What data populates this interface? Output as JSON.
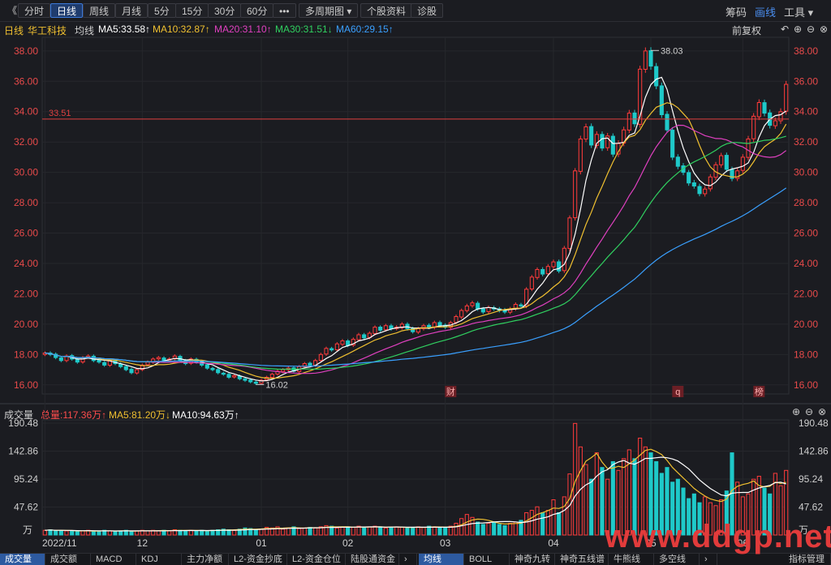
{
  "toolbar": {
    "back_glyph": "《",
    "periods": [
      "分时",
      "日线",
      "周线",
      "月线",
      "5分",
      "15分",
      "30分",
      "60分",
      "•••",
      "多周期图 ▾",
      "个股资料",
      "诊股"
    ],
    "active_period": "日线",
    "right_items": [
      "筹码",
      "画线",
      "工具 ▾"
    ],
    "right_active": "画线"
  },
  "indicator_row": {
    "period": "日线",
    "stock": "华工科技",
    "avg_label": "均线",
    "ma": [
      {
        "label": "MA5:33.58↑",
        "color": "#ffffff"
      },
      {
        "label": "MA10:32.87↑",
        "color": "#f0c030"
      },
      {
        "label": "MA20:31.10↑",
        "color": "#e040c0"
      },
      {
        "label": "MA30:31.51↓",
        "color": "#30d060"
      },
      {
        "label": "MA60:29.15↑",
        "color": "#3aa0ff"
      }
    ],
    "adjust": "前复权",
    "icons": [
      "undo-icon",
      "add-icon",
      "minus-icon",
      "close-icon"
    ]
  },
  "volume_row": {
    "label": "成交量",
    "total": "总量:117.36万↑",
    "ma5": "MA5:81.20万↓",
    "ma10": "MA10:94.63万↑"
  },
  "colors": {
    "up": "#ff3b3b",
    "down": "#1fc9c9",
    "ma5": "#ffffff",
    "ma10": "#f0c030",
    "ma20": "#e040c0",
    "ma30": "#30d060",
    "ma60": "#3aa0ff"
  },
  "chart_data": {
    "type": "candlestick",
    "price_ticks": [
      "38.00",
      "36.00",
      "34.00",
      "32.00",
      "30.00",
      "28.00",
      "26.00",
      "24.00",
      "22.00",
      "20.00",
      "18.00",
      "16.00"
    ],
    "ylim": [
      15.4,
      38.9
    ],
    "ref_line": {
      "value": 33.51,
      "label": "33.51"
    },
    "high_marker": {
      "value": 38.03,
      "label": "38.03"
    },
    "low_marker": {
      "value": 16.02,
      "label": "16.02"
    },
    "x_labels": [
      {
        "label": "2022/11",
        "index": 0
      },
      {
        "label": "12",
        "index": 18
      },
      {
        "label": "01",
        "index": 40
      },
      {
        "label": "02",
        "index": 56
      },
      {
        "label": "03",
        "index": 74
      },
      {
        "label": "04",
        "index": 94
      },
      {
        "label": "05",
        "index": 112
      },
      {
        "label": "06",
        "index": 129
      }
    ],
    "event_markers": [
      {
        "label": "财",
        "index": 75
      },
      {
        "label": "q",
        "index": 117
      },
      {
        "label": "榜",
        "index": 132
      }
    ],
    "volume_ticks": [
      "190.48",
      "142.86",
      "95.24",
      "47.62"
    ],
    "volume_unit": "万",
    "volume_max": 196,
    "closes": [
      18.1,
      18.0,
      17.8,
      17.6,
      17.9,
      17.7,
      17.5,
      17.8,
      17.9,
      17.6,
      17.5,
      17.3,
      17.6,
      17.4,
      17.2,
      17.0,
      16.8,
      17.0,
      17.3,
      17.5,
      17.7,
      17.8,
      17.6,
      17.7,
      17.9,
      17.6,
      17.4,
      17.7,
      17.5,
      17.3,
      17.1,
      17.0,
      16.8,
      16.7,
      16.5,
      16.6,
      16.4,
      16.3,
      16.2,
      16.1,
      16.3,
      16.5,
      16.7,
      16.9,
      17.0,
      17.1,
      16.9,
      17.2,
      17.4,
      17.3,
      17.6,
      18.0,
      18.4,
      18.3,
      18.7,
      18.9,
      18.6,
      19.0,
      19.3,
      19.1,
      19.4,
      19.8,
      19.6,
      19.9,
      19.7,
      19.8,
      20.0,
      19.7,
      19.5,
      19.7,
      19.9,
      19.8,
      20.1,
      19.9,
      19.8,
      20.1,
      20.5,
      20.9,
      21.2,
      21.4,
      21.0,
      20.8,
      21.1,
      21.0,
      20.9,
      20.8,
      21.0,
      21.3,
      21.2,
      22.3,
      23.1,
      23.6,
      23.3,
      23.8,
      24.1,
      23.5,
      25.0,
      27.0,
      30.1,
      32.2,
      33.0,
      31.8,
      32.5,
      31.6,
      32.4,
      31.2,
      31.9,
      32.8,
      33.9,
      33.2,
      36.8,
      38.0,
      37.0,
      35.7,
      33.8,
      32.8,
      31.0,
      30.4,
      30.0,
      29.3,
      29.1,
      28.6,
      28.9,
      29.7,
      30.5,
      31.1,
      30.2,
      29.6,
      30.1,
      31.0,
      32.2,
      33.7,
      34.6,
      33.9,
      33.1,
      33.4,
      34.0,
      35.8
    ],
    "volumes": [
      8,
      9,
      7,
      8,
      7,
      7,
      6,
      7,
      8,
      6,
      7,
      8,
      7,
      6,
      7,
      8,
      6,
      7,
      8,
      7,
      8,
      7,
      8,
      7,
      9,
      8,
      7,
      8,
      7,
      8,
      7,
      8,
      9,
      10,
      9,
      8,
      10,
      12,
      11,
      9,
      10,
      13,
      12,
      14,
      10,
      12,
      14,
      11,
      12,
      13,
      12,
      14,
      16,
      15,
      12,
      13,
      14,
      13,
      15,
      12,
      14,
      15,
      14,
      12,
      13,
      14,
      13,
      12,
      13,
      14,
      13,
      15,
      14,
      12,
      12,
      15,
      20,
      28,
      35,
      30,
      22,
      18,
      20,
      22,
      18,
      16,
      20,
      22,
      25,
      38,
      42,
      48,
      38,
      42,
      60,
      38,
      65,
      104,
      190,
      150,
      120,
      95,
      140,
      115,
      95,
      125,
      110,
      130,
      145,
      130,
      165,
      150,
      140,
      125,
      105,
      115,
      90,
      95,
      80,
      62,
      70,
      55,
      65,
      55,
      50,
      60,
      75,
      140,
      90,
      65,
      70,
      95,
      100,
      80,
      70,
      105,
      84,
      110
    ]
  }
}
